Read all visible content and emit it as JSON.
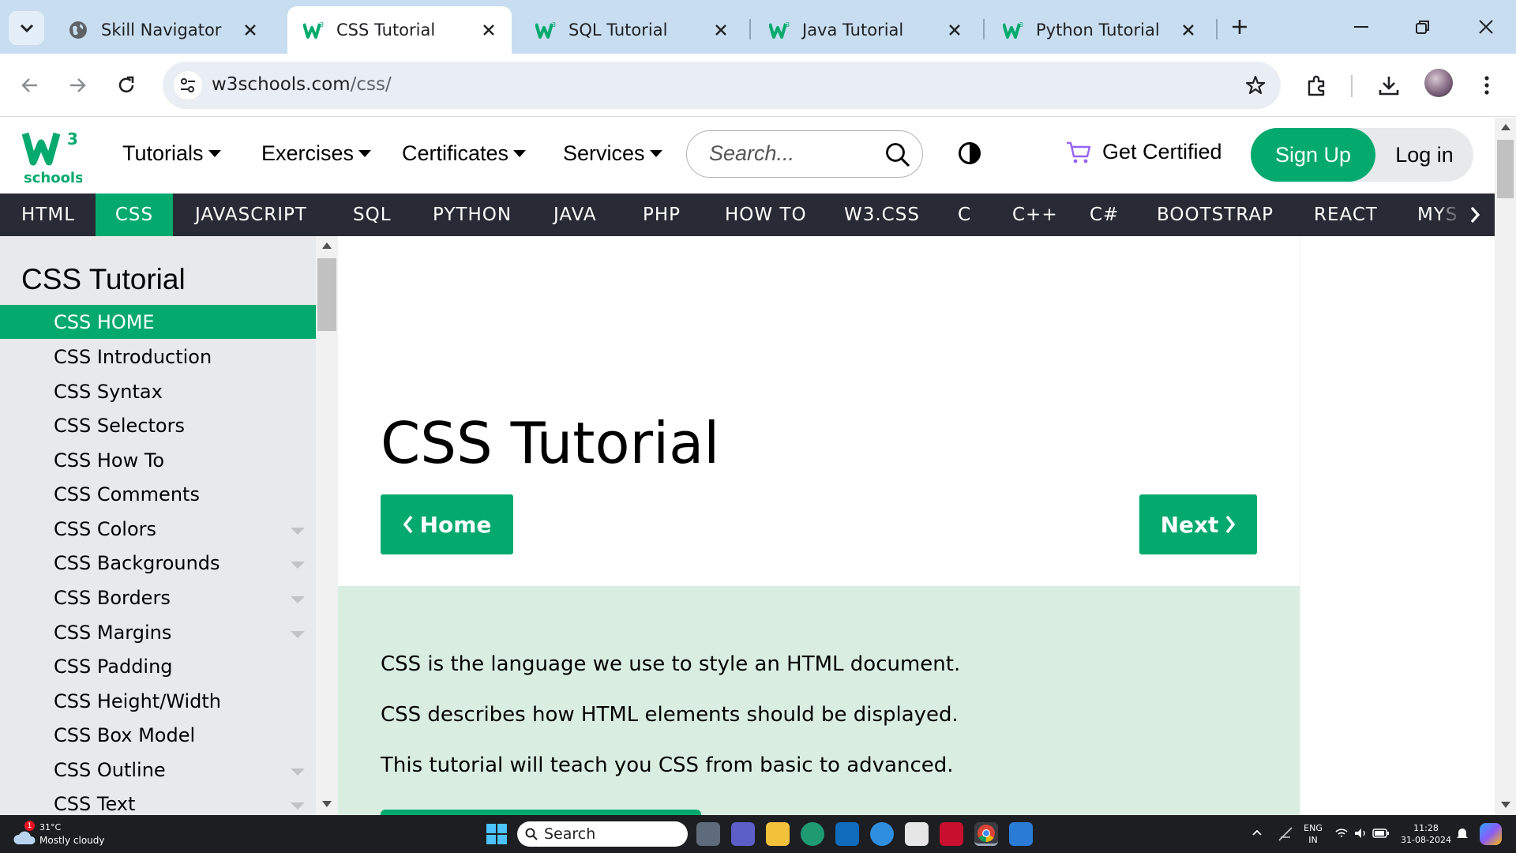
{
  "browser": {
    "tabs": [
      {
        "label": "Skill Navigator"
      },
      {
        "label": "CSS Tutorial"
      },
      {
        "label": "SQL Tutorial"
      },
      {
        "label": "Java Tutorial"
      },
      {
        "label": "Python Tutorial"
      }
    ],
    "url_host": "w3schools.com",
    "url_path": "/css/"
  },
  "header": {
    "logo_sup": "3",
    "logo_text": "schools",
    "nav": [
      {
        "label": "Tutorials"
      },
      {
        "label": "Exercises"
      },
      {
        "label": "Certificates"
      },
      {
        "label": "Services"
      }
    ],
    "search_placeholder": "Search...",
    "get_certified": "Get Certified",
    "sign_up": "Sign Up",
    "log_in": "Log in"
  },
  "topnav": {
    "items": [
      {
        "label": "HTML"
      },
      {
        "label": "CSS"
      },
      {
        "label": "JAVASCRIPT"
      },
      {
        "label": "SQL"
      },
      {
        "label": "PYTHON"
      },
      {
        "label": "JAVA"
      },
      {
        "label": "PHP"
      },
      {
        "label": "HOW TO"
      },
      {
        "label": "W3.CSS"
      },
      {
        "label": "C"
      },
      {
        "label": "C++"
      },
      {
        "label": "C#"
      },
      {
        "label": "BOOTSTRAP"
      },
      {
        "label": "REACT"
      },
      {
        "label": "MYS"
      }
    ],
    "active": "CSS"
  },
  "sidebar": {
    "title": "CSS Tutorial",
    "items": [
      {
        "label": "CSS HOME",
        "active": true
      },
      {
        "label": "CSS Introduction"
      },
      {
        "label": "CSS Syntax"
      },
      {
        "label": "CSS Selectors"
      },
      {
        "label": "CSS How To"
      },
      {
        "label": "CSS Comments"
      },
      {
        "label": "CSS Colors",
        "expandable": true
      },
      {
        "label": "CSS Backgrounds",
        "expandable": true
      },
      {
        "label": "CSS Borders",
        "expandable": true
      },
      {
        "label": "CSS Margins",
        "expandable": true
      },
      {
        "label": "CSS Padding"
      },
      {
        "label": "CSS Height/Width"
      },
      {
        "label": "CSS Box Model"
      },
      {
        "label": "CSS Outline",
        "expandable": true
      },
      {
        "label": "CSS Text",
        "expandable": true
      }
    ]
  },
  "main": {
    "title": "CSS Tutorial",
    "home_button": "Home",
    "next_button": "Next",
    "intro": [
      "CSS is the language we use to style an HTML document.",
      "CSS describes how HTML elements should be displayed.",
      "This tutorial will teach you CSS from basic to advanced."
    ]
  },
  "taskbar": {
    "weather_temp": "31°C",
    "weather_desc": "Mostly cloudy",
    "weather_badge": "1",
    "search_label": "Search",
    "lang_line1": "ENG",
    "lang_line2": "IN",
    "time": "11:28",
    "date": "31-08-2024"
  },
  "colors": {
    "accent": "#04aa6d",
    "topnav_bg": "#282a35",
    "sidebar_bg": "#e7e9eb",
    "intro_bg": "#d9eee1",
    "tabstrip_bg": "#c8ddf0"
  }
}
